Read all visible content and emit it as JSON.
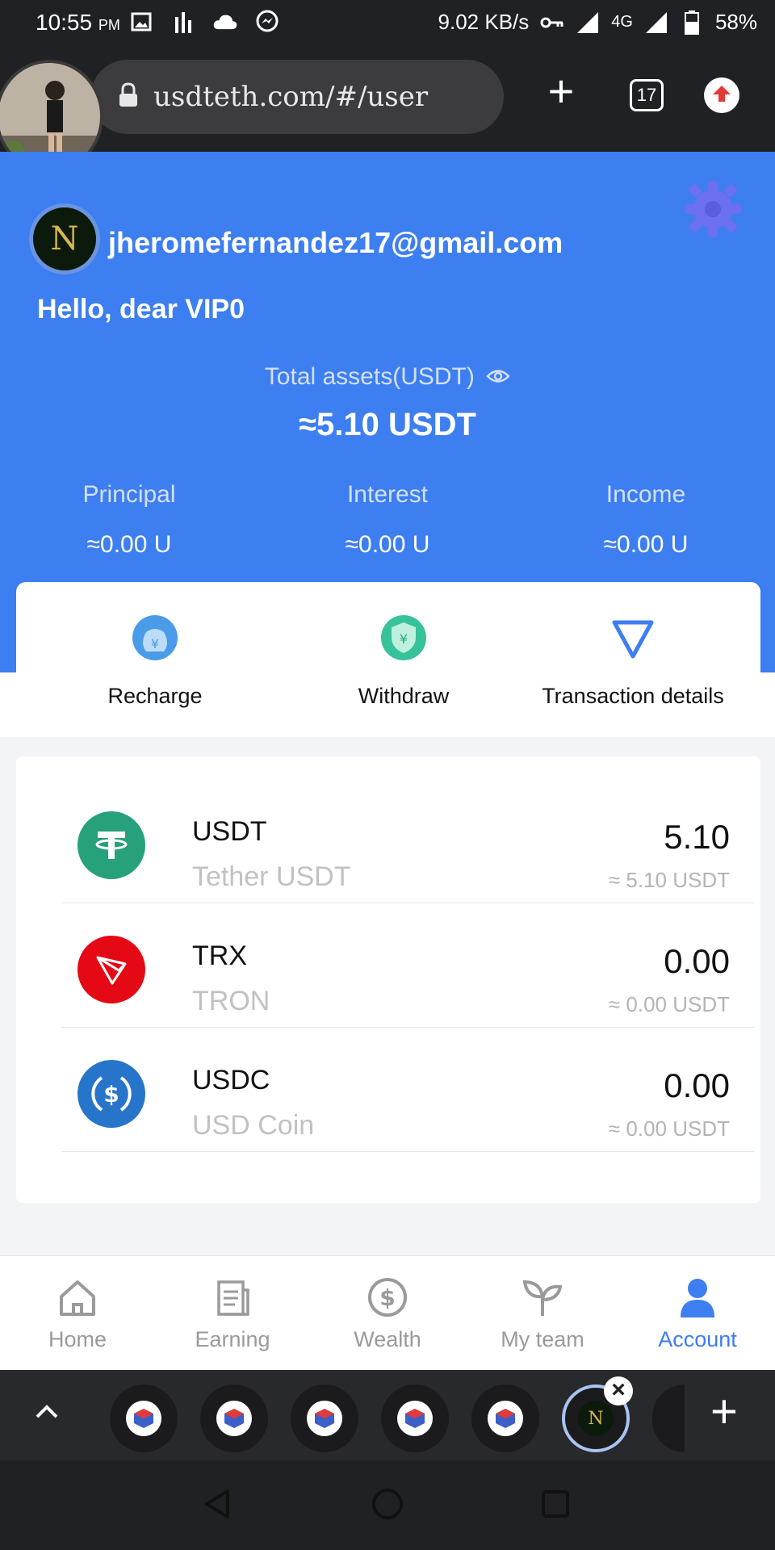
{
  "status_bar": {
    "time": "10:55",
    "ampm": "PM",
    "net_speed": "9.02 KB/s",
    "network": "4G",
    "battery": "58%"
  },
  "browser": {
    "url": "usdteth.com/#/user",
    "tab_count": "17"
  },
  "header": {
    "email": "jheromefernandez17@gmail.com",
    "greeting": "Hello, dear VIP0",
    "total_label": "Total assets(USDT)",
    "total_value": "≈5.10 USDT",
    "stats": [
      {
        "label": "Principal",
        "value": "≈0.00 U"
      },
      {
        "label": "Interest",
        "value": "≈0.00 U"
      },
      {
        "label": "Income",
        "value": "≈0.00 U"
      }
    ],
    "accent_color": "#3d7ef0"
  },
  "actions": [
    {
      "label": "Recharge",
      "icon": "money-bag-icon"
    },
    {
      "label": "Withdraw",
      "icon": "shield-yen-icon"
    },
    {
      "label": "Transaction details",
      "icon": "triangle-icon"
    }
  ],
  "assets": [
    {
      "symbol": "USDT",
      "name": "Tether USDT",
      "amount": "5.10",
      "usdt": "≈ 5.10 USDT",
      "color": "#26a17b"
    },
    {
      "symbol": "TRX",
      "name": "TRON",
      "amount": "0.00",
      "usdt": "≈ 0.00 USDT",
      "color": "#e50915"
    },
    {
      "symbol": "USDC",
      "name": "USD Coin",
      "amount": "0.00",
      "usdt": "≈ 0.00 USDT",
      "color": "#2775ca"
    }
  ],
  "tabs": [
    {
      "label": "Home",
      "icon": "home-icon"
    },
    {
      "label": "Earning",
      "icon": "document-icon"
    },
    {
      "label": "Wealth",
      "icon": "dollar-circle-icon"
    },
    {
      "label": "My team",
      "icon": "sprout-icon"
    },
    {
      "label": "Account",
      "icon": "person-icon",
      "active": true
    }
  ]
}
